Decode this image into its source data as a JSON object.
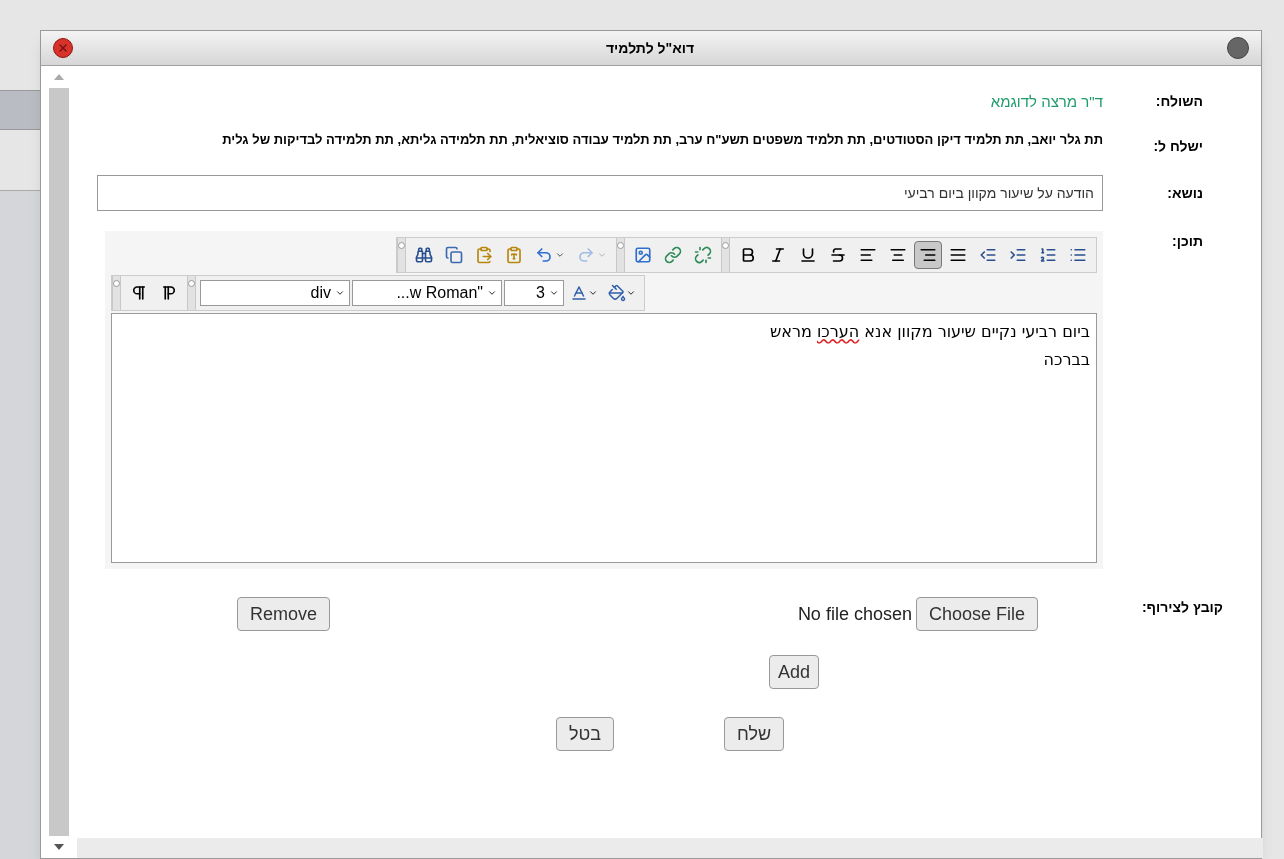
{
  "window": {
    "title": "דוא\"ל לתלמיד"
  },
  "fields": {
    "sender_label": "השולח:",
    "sender": "ד\"ר מרצה לדוגמא",
    "recipients_label": "ישלח ל:",
    "recipients": "תת גלר יואב, תת תלמיד דיקן הסטודטים, תת תלמיד משפטים תשע\"ח ערב, תת תלמיד עבודה סוציאלית, תת תלמידה גליתא, תת תלמידה לבדיקות של גלית",
    "subject_label": "נושא:",
    "subject": "הודעה על שיעור מקוון ביום רביעי",
    "content_label": "תוכן:"
  },
  "toolbar": {
    "row_1": [
      [
        {
          "kind": "find",
          "selected": false,
          "disabled": false
        },
        {
          "kind": "copy",
          "selected": false,
          "disabled": false
        },
        {
          "kind": "paste",
          "selected": false,
          "disabled": false
        },
        {
          "kind": "paste-word",
          "selected": false,
          "disabled": false
        },
        {
          "kind": "undo",
          "selected": false,
          "disabled": false
        },
        {
          "kind": "redo",
          "selected": false,
          "disabled": true
        }
      ],
      [
        {
          "kind": "image",
          "selected": false,
          "disabled": false
        },
        {
          "kind": "link",
          "selected": false,
          "disabled": false
        },
        {
          "kind": "unlink",
          "selected": false,
          "disabled": false
        }
      ],
      [
        {
          "kind": "bold",
          "selected": false,
          "disabled": false
        },
        {
          "kind": "italic",
          "selected": false,
          "disabled": false
        },
        {
          "kind": "underline",
          "selected": false,
          "disabled": false
        },
        {
          "kind": "strike",
          "selected": false,
          "disabled": false
        },
        {
          "kind": "align-left",
          "selected": false,
          "disabled": false
        },
        {
          "kind": "align-center",
          "selected": false,
          "disabled": false
        },
        {
          "kind": "align-right",
          "selected": true,
          "disabled": false
        },
        {
          "kind": "justify",
          "selected": false,
          "disabled": false
        },
        {
          "kind": "outdent",
          "selected": false,
          "disabled": false
        },
        {
          "kind": "indent",
          "selected": false,
          "disabled": false
        },
        {
          "kind": "ordered-list",
          "selected": false,
          "disabled": false
        },
        {
          "kind": "bullet-list",
          "selected": false,
          "disabled": false
        }
      ]
    ],
    "row_2_buttons": [
      {
        "kind": "ltr",
        "selected": false,
        "disabled": false
      },
      {
        "kind": "rtl",
        "selected": false,
        "disabled": false
      }
    ],
    "format": "div",
    "font": "...w Roman\"",
    "size": "3"
  },
  "editor": {
    "lines": [
      [
        {
          "text": "ביום רביעי נקיים שיעור מקוון אנא ",
          "misspelled": false
        },
        {
          "text": "הערכו",
          "misspelled": true
        },
        {
          "text": " מראש",
          "misspelled": false
        }
      ],
      [
        {
          "text": "בברכה",
          "misspelled": false
        }
      ]
    ]
  },
  "attachment": {
    "label": "קובץ לצירוף:",
    "status": "No file chosen",
    "choose": "Choose File",
    "remove": "Remove",
    "add": "Add"
  },
  "buttons": {
    "send": "שלח",
    "cancel": "בטל"
  }
}
